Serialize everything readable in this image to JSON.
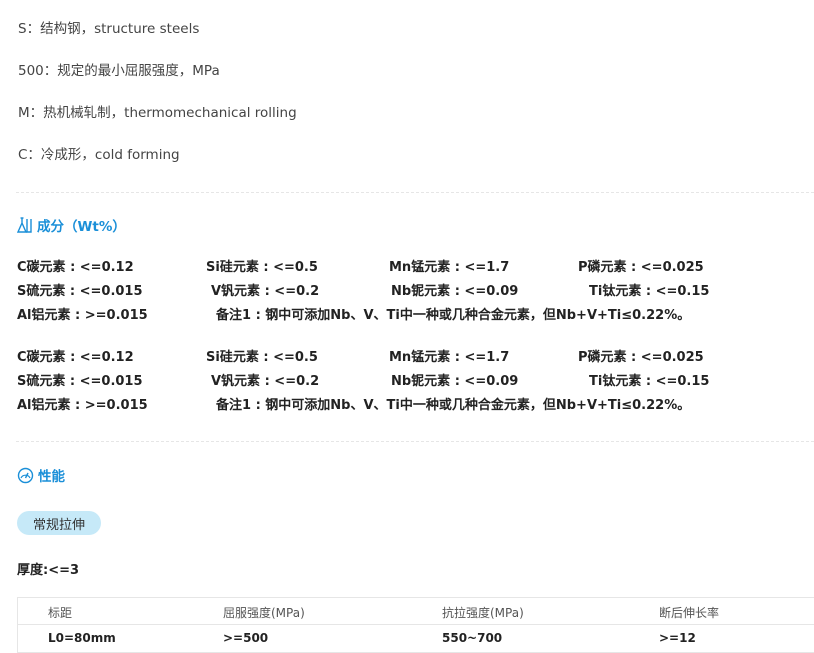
{
  "definitions": [
    "S：结构钢，structure steels",
    "500：规定的最小屈服强度，MPa",
    "M：热机械轧制，thermomechanical rolling",
    "C：冷成形，cold forming"
  ],
  "composition": {
    "title": "成分（Wt%）",
    "icon": "flask-icon",
    "blocks": [
      {
        "row1": [
          "C碳元素 : <=0.12",
          "Si硅元素 : <=0.5",
          "Mn锰元素 : <=1.7",
          "P磷元素 : <=0.025"
        ],
        "row2": [
          "S硫元素 : <=0.015",
          "V钒元素 : <=0.2",
          "Nb铌元素 : <=0.09",
          "Ti钛元素 : <=0.15"
        ],
        "row3": [
          "Al铝元素 : >=0.015",
          "备注1 : 钢中可添加Nb、V、Ti中一种或几种合金元素，但Nb+V+Ti≤0.22%。"
        ]
      },
      {
        "row1": [
          "C碳元素 : <=0.12",
          "Si硅元素 : <=0.5",
          "Mn锰元素 : <=1.7",
          "P磷元素 : <=0.025"
        ],
        "row2": [
          "S硫元素 : <=0.015",
          "V钒元素 : <=0.2",
          "Nb铌元素 : <=0.09",
          "Ti钛元素 : <=0.15"
        ],
        "row3": [
          "Al铝元素 : >=0.015",
          "备注1 : 钢中可添加Nb、V、Ti中一种或几种合金元素，但Nb+V+Ti≤0.22%。"
        ]
      }
    ]
  },
  "performance": {
    "title": "性能",
    "icon": "gauge-icon",
    "tab_label": "常规拉伸",
    "thickness": "厚度:<=3",
    "table": {
      "headers": [
        "标距",
        "屈服强度(MPa)",
        "抗拉强度(MPa)",
        "断后伸长率"
      ],
      "rows": [
        [
          "L0=80mm",
          ">=500",
          "550~700",
          ">=12"
        ]
      ]
    }
  },
  "colors": {
    "accent": "#1a8fd8",
    "pill": "#c6e9f8"
  }
}
